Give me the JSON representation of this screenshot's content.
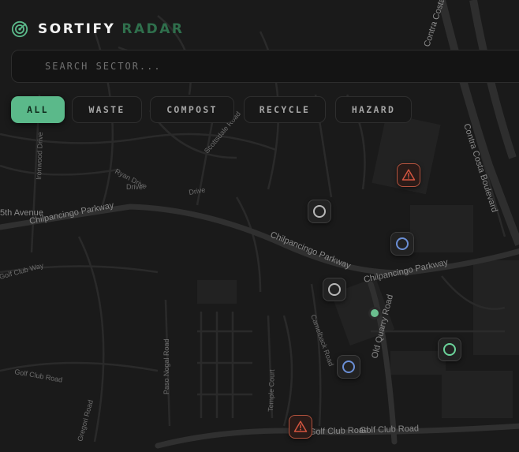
{
  "brand": {
    "name": "SORTIFY",
    "subtitle": "RADAR",
    "accent_color": "#5bb98a",
    "icon": "radar-target-icon"
  },
  "search": {
    "placeholder": "SEARCH SECTOR...",
    "value": ""
  },
  "filters": [
    {
      "label": "ALL",
      "active": true
    },
    {
      "label": "WASTE",
      "active": false
    },
    {
      "label": "COMPOST",
      "active": false
    },
    {
      "label": "RECYCLE",
      "active": false
    },
    {
      "label": "HAZARD",
      "active": false
    }
  ],
  "map": {
    "road_labels": [
      "Chilpancingo Parkway",
      "Chilpancingo Parkway",
      "Chilpancingo Parkway",
      "Contra Costa Boulevard",
      "Contra Costa Blvd",
      "Golf Club Road",
      "Golf Club Road",
      "Golf Club Road",
      "Golf Club Way",
      "Old Quarry Road",
      "Scottsdale Road",
      "Ryan Drive",
      "Ironwood Drive",
      "Paso Nogal Road",
      "Gregori Road",
      "Camelback Road",
      "Temple Court",
      "5th Avenue",
      "Drive",
      "Drive"
    ]
  },
  "markers": [
    {
      "type": "hazard",
      "icon": "warning-triangle-icon",
      "color": "#d4553f"
    },
    {
      "type": "waste",
      "icon": "ring-icon",
      "color": "#b8b8b8"
    },
    {
      "type": "recycle",
      "icon": "ring-icon",
      "color": "#6b8fd6"
    },
    {
      "type": "waste",
      "icon": "ring-icon",
      "color": "#b8b8b8"
    },
    {
      "type": "compost",
      "icon": "dot-icon",
      "color": "#6bbf8f"
    },
    {
      "type": "compost",
      "icon": "ring-icon",
      "color": "#6bd39a"
    },
    {
      "type": "recycle",
      "icon": "ring-icon",
      "color": "#6b8fd6"
    },
    {
      "type": "hazard",
      "icon": "warning-triangle-icon",
      "color": "#d4553f"
    }
  ]
}
